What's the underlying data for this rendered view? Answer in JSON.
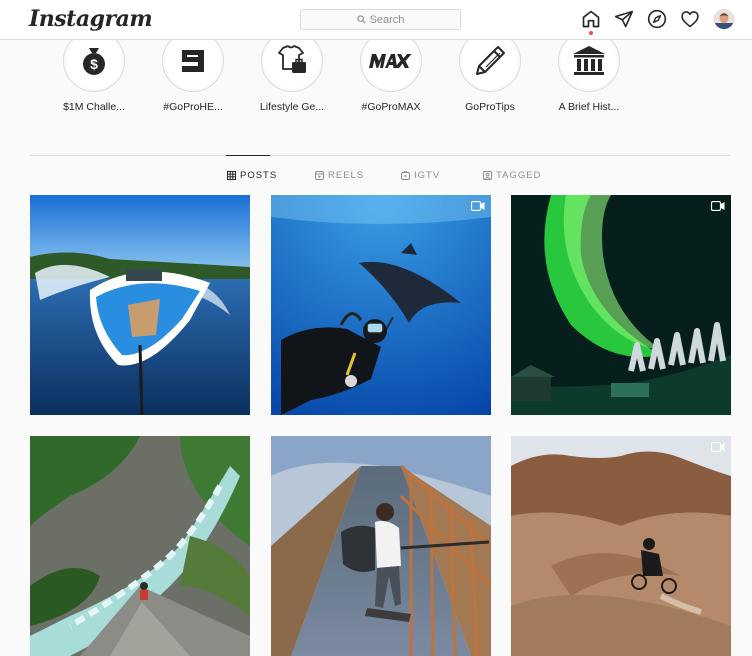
{
  "app": {
    "name": "Instagram"
  },
  "search": {
    "placeholder": "Search"
  },
  "nav": [
    "home-icon",
    "direct-icon",
    "explore-icon",
    "activity-icon",
    "avatar"
  ],
  "highlights": [
    {
      "label": "$1M Challe...",
      "icon": "money-bag-icon"
    },
    {
      "label": "#GoProHE...",
      "icon": "hero9-logo-icon"
    },
    {
      "label": "Lifestyle Ge...",
      "icon": "shirt-bag-icon"
    },
    {
      "label": "#GoProMAX",
      "icon": "max-logo-icon"
    },
    {
      "label": "GoProTips",
      "icon": "pencil-icon"
    },
    {
      "label": "A Brief Hist...",
      "icon": "museum-icon"
    }
  ],
  "tabs": [
    {
      "label": "POSTS",
      "icon": "grid-icon",
      "active": true
    },
    {
      "label": "REELS",
      "icon": "reels-icon",
      "active": false
    },
    {
      "label": "IGTV",
      "icon": "igtv-icon",
      "active": false
    },
    {
      "label": "TAGGED",
      "icon": "tagged-icon",
      "active": false
    }
  ],
  "posts": [
    {
      "subject": "speedboat-on-lake",
      "video": false
    },
    {
      "subject": "diver-with-manta-ray",
      "video": true
    },
    {
      "subject": "northern-lights",
      "video": true
    },
    {
      "subject": "river-canyon",
      "video": false
    },
    {
      "subject": "bridge-skateboarder",
      "video": false
    },
    {
      "subject": "desert-mountain-biker",
      "video": true
    }
  ],
  "colors": {
    "border": "#dbdbdb",
    "text": "#262626",
    "muted": "#8e8e8e",
    "notification": "#ed4956"
  }
}
